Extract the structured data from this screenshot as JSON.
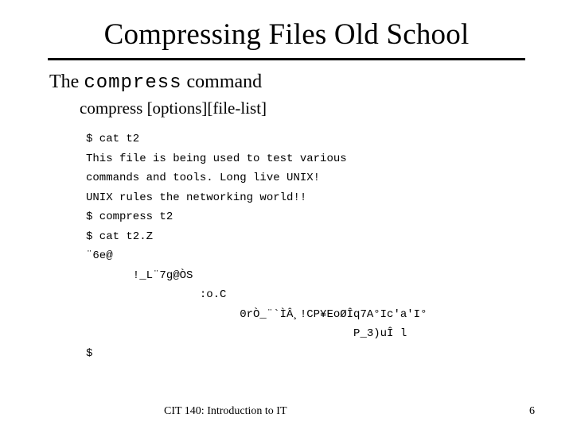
{
  "title": "Compressing Files Old School",
  "subhead_prefix": "The ",
  "subhead_cmd": "compress",
  "subhead_suffix": " command",
  "syntax": "compress [options][file-list]",
  "terminal": {
    "l1": "$ cat t2",
    "l2": "This file is being used to test various",
    "l3": "commands and tools. Long live UNIX!",
    "l4": "UNIX rules the networking world!!",
    "l5": "$ compress t2",
    "l6": "$ cat t2.Z",
    "l7": "¨6e@",
    "l8": "       !_L¨7g@ÒS",
    "l9": "                 :o.C",
    "l10": "                       0rÒ_¨`ÌÂ¸!CP¥EoØÎq7A°Ic'a'I°",
    "l11": "                                        P_3)uÎ l",
    "l12": "$"
  },
  "footer": {
    "course": "CIT 140: Introduction to IT",
    "page": "6"
  }
}
